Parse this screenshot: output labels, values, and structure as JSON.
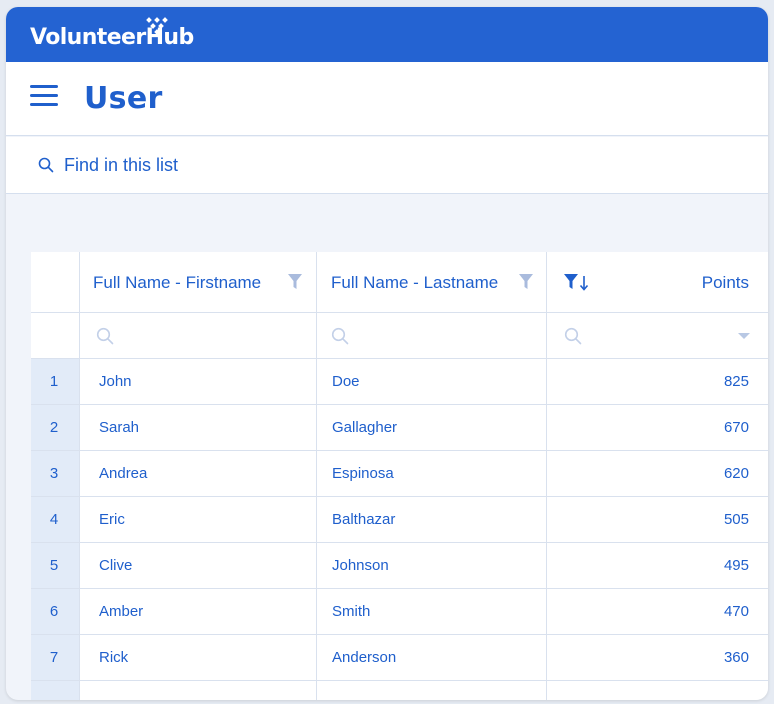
{
  "brand": {
    "name": "VolunteerHub"
  },
  "header": {
    "title": "User",
    "menu_icon": "hamburger-menu-icon"
  },
  "search": {
    "placeholder": "Find in this list",
    "icon": "search-icon"
  },
  "colors": {
    "brand_blue": "#2463d2",
    "text_blue": "#1f5fcc",
    "row_number_bg": "#e2ebf8",
    "page_bg": "#f1f4fa"
  },
  "table": {
    "columns": [
      {
        "label": "Full Name - Firstname",
        "icon": "filter-icon"
      },
      {
        "label": "Full Name - Lastname",
        "icon": "filter-icon"
      },
      {
        "label": "Points",
        "icon": "filter-sort-descending-icon"
      }
    ],
    "rows": [
      {
        "n": "1",
        "first": "John",
        "last": "Doe",
        "points": "825"
      },
      {
        "n": "2",
        "first": "Sarah",
        "last": "Gallagher",
        "points": "670"
      },
      {
        "n": "3",
        "first": "Andrea",
        "last": "Espinosa",
        "points": "620"
      },
      {
        "n": "4",
        "first": "Eric",
        "last": "Balthazar",
        "points": "505"
      },
      {
        "n": "5",
        "first": "Clive",
        "last": "Johnson",
        "points": "495"
      },
      {
        "n": "6",
        "first": "Amber",
        "last": "Smith",
        "points": "470"
      },
      {
        "n": "7",
        "first": "Rick",
        "last": "Anderson",
        "points": "360"
      }
    ]
  }
}
